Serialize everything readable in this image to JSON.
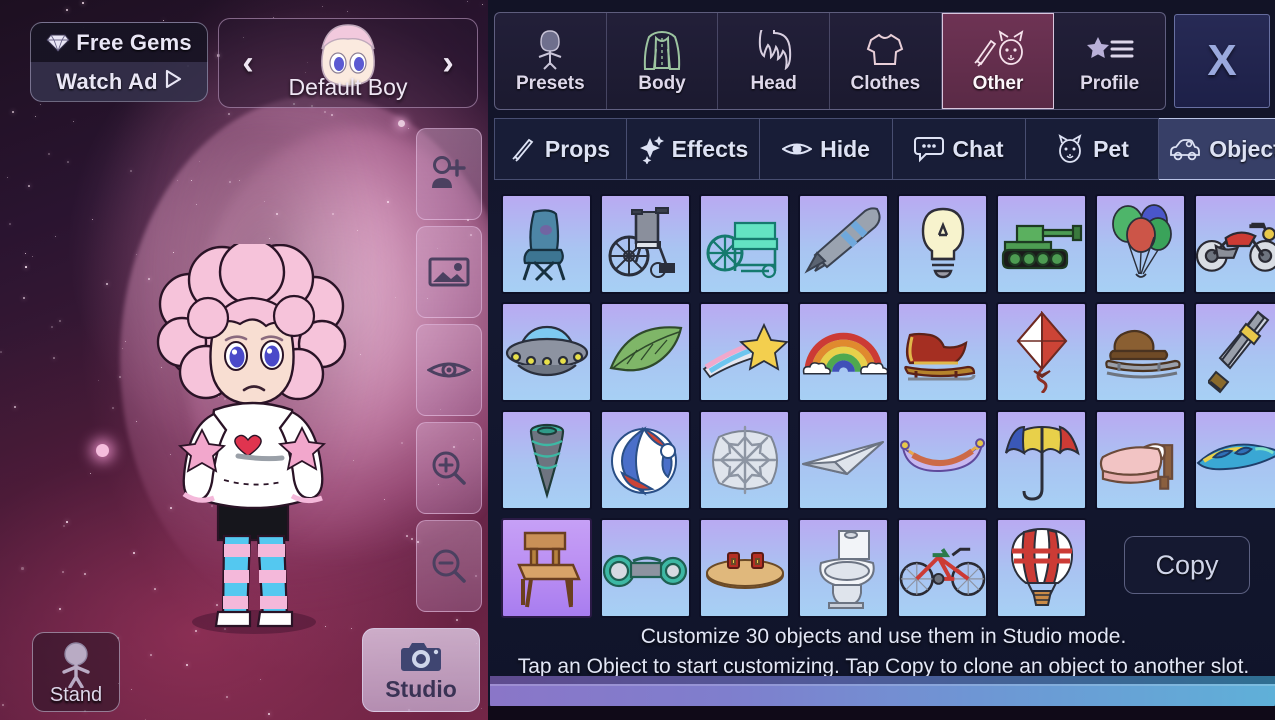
{
  "scene": {
    "gems_button": {
      "title": "Free Gems",
      "subtitle": "Watch Ad",
      "icon": "gem-icon",
      "play_icon": "play-triangle-icon"
    },
    "character_selector": {
      "prev_arrow": "‹",
      "next_arrow": "›",
      "name": "Default Boy",
      "avatar_icon": "character-face-icon"
    },
    "tools": [
      {
        "name": "add-character",
        "icon": "person-plus-icon"
      },
      {
        "name": "background",
        "icon": "image-icon"
      },
      {
        "name": "preview-hide",
        "icon": "eye-icon"
      },
      {
        "name": "zoom-in",
        "icon": "zoom-in-icon"
      },
      {
        "name": "zoom-out",
        "icon": "zoom-out-icon"
      }
    ],
    "stand_button": {
      "label": "Stand",
      "icon": "standing-person-icon"
    },
    "studio_button": {
      "label": "Studio",
      "icon": "camera-icon"
    },
    "character": {
      "hair_color": "#f6c3da",
      "skin_color": "#f8ded2",
      "eye_color": "#4a49c9",
      "top_color": "#ffffff",
      "shorts_color": "#1b1b22",
      "stocking_colors": [
        "#54c8f0",
        "#f4b8da"
      ],
      "shoe_color": "#ffffff"
    }
  },
  "panel": {
    "category_tabs": [
      {
        "label": "Presets",
        "icon": "preset-body-icon",
        "active": false
      },
      {
        "label": "Body",
        "icon": "jacket-icon",
        "active": false
      },
      {
        "label": "Head",
        "icon": "hair-icon",
        "active": false
      },
      {
        "label": "Clothes",
        "icon": "tshirt-icon",
        "active": false
      },
      {
        "label": "Other",
        "icon": "sword-cat-icon",
        "active": true
      },
      {
        "label": "Profile",
        "icon": "star-list-icon",
        "active": false
      }
    ],
    "close_button": {
      "label": "X",
      "icon": "close-icon"
    },
    "sub_tabs": [
      {
        "label": "Props",
        "icon": "sword-icon",
        "active": false
      },
      {
        "label": "Effects",
        "icon": "sparkle-icon",
        "active": false
      },
      {
        "label": "Hide",
        "icon": "eye-icon",
        "active": false
      },
      {
        "label": "Chat",
        "icon": "chat-bubble-icon",
        "active": false
      },
      {
        "label": "Pet",
        "icon": "cat-face-icon",
        "active": false
      },
      {
        "label": "Object",
        "icon": "car-icon",
        "active": true
      }
    ],
    "copy_button": {
      "label": "Copy"
    },
    "hint_line_1": "Customize 30 objects and use them in Studio mode.",
    "hint_line_2": "Tap an Object to start customizing. Tap Copy to clone an object to another slot.",
    "grid": {
      "columns": 8,
      "rows": 4,
      "items": [
        {
          "name": "blue-chair",
          "selected": false
        },
        {
          "name": "wheelchair-grey",
          "selected": false
        },
        {
          "name": "wheelchair-teal",
          "selected": false
        },
        {
          "name": "rocket",
          "selected": false
        },
        {
          "name": "lightbulb",
          "selected": false
        },
        {
          "name": "tank",
          "selected": false
        },
        {
          "name": "balloons",
          "selected": false
        },
        {
          "name": "motorcycle",
          "selected": false
        },
        {
          "name": "ufo",
          "selected": false
        },
        {
          "name": "leaf",
          "selected": false
        },
        {
          "name": "shooting-star",
          "selected": false
        },
        {
          "name": "rainbow",
          "selected": false
        },
        {
          "name": "sleigh",
          "selected": false
        },
        {
          "name": "kite",
          "selected": false
        },
        {
          "name": "sled",
          "selected": false
        },
        {
          "name": "sword",
          "selected": false
        },
        {
          "name": "spinning-top",
          "selected": false
        },
        {
          "name": "beach-ball",
          "selected": false
        },
        {
          "name": "snowflake-ornament",
          "selected": false
        },
        {
          "name": "paper-plane",
          "selected": false
        },
        {
          "name": "hammock",
          "selected": false
        },
        {
          "name": "umbrella",
          "selected": false
        },
        {
          "name": "bed",
          "selected": false
        },
        {
          "name": "surfboard",
          "selected": false
        },
        {
          "name": "wooden-chair",
          "selected": true
        },
        {
          "name": "hoverboard",
          "selected": false
        },
        {
          "name": "low-table",
          "selected": false
        },
        {
          "name": "toilet",
          "selected": false
        },
        {
          "name": "bicycle",
          "selected": false
        },
        {
          "name": "hot-air-balloon",
          "selected": false
        }
      ]
    }
  },
  "colors": {
    "panel_bg": "#121326",
    "tab_active": "#6e3354",
    "cell_bg_normal": "#b0b9f2",
    "cell_bg_selected": "#bb92f4",
    "accent_text": "#e3e7f6"
  }
}
